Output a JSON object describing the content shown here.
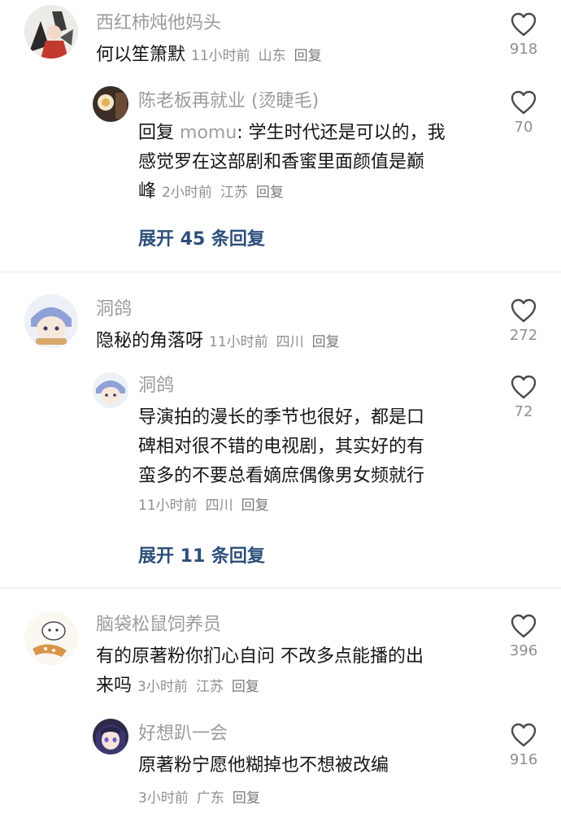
{
  "comments": [
    {
      "user": "西红柿炖他妈头",
      "text": "何以笙箫默",
      "time": "11小时前",
      "location": "山东",
      "reply_label": "回复",
      "likes": "918",
      "reply": {
        "user": "陈老板再就业 (烫睫毛)",
        "prefix": "回复",
        "mention": "momu",
        "line1": ": 学生时代还是可以的，我",
        "line2": "感觉罗在这部剧和香蜜里面颜值是巅",
        "line3": "峰",
        "time": "2小时前",
        "location": "江苏",
        "reply_label": "回复",
        "likes": "70"
      },
      "expand": "展开 45 条回复"
    },
    {
      "user": "洞鸽",
      "text": "隐秘的角落呀",
      "time": "11小时前",
      "location": "四川",
      "reply_label": "回复",
      "likes": "272",
      "reply": {
        "user": "洞鸽",
        "line1": "导演拍的漫长的季节也很好，都是口",
        "line2": "碑相对很不错的电视剧，其实好的有",
        "line3": "蛮多的不要总看嫡庶偶像男女频就行",
        "time": "11小时前",
        "location": "四川",
        "reply_label": "回复",
        "likes": "72"
      },
      "expand": "展开 11 条回复"
    },
    {
      "user": "脑袋松鼠饲养员",
      "line1": "有的原著粉你扪心自问 不改多点能播的出",
      "line2": "来吗",
      "time": "3小时前",
      "location": "江苏",
      "reply_label": "回复",
      "likes": "396",
      "reply": {
        "user": "好想趴一会",
        "line1": "原著粉宁愿他糊掉也不想被改编",
        "time": "3小时前",
        "location": "广东",
        "reply_label": "回复",
        "likes": "916"
      }
    }
  ],
  "icons": {
    "like": "heart-outline-icon"
  },
  "colors": {
    "link": "#2d4f7a",
    "muted": "#8f8f8f",
    "username": "#9b9b9b"
  }
}
